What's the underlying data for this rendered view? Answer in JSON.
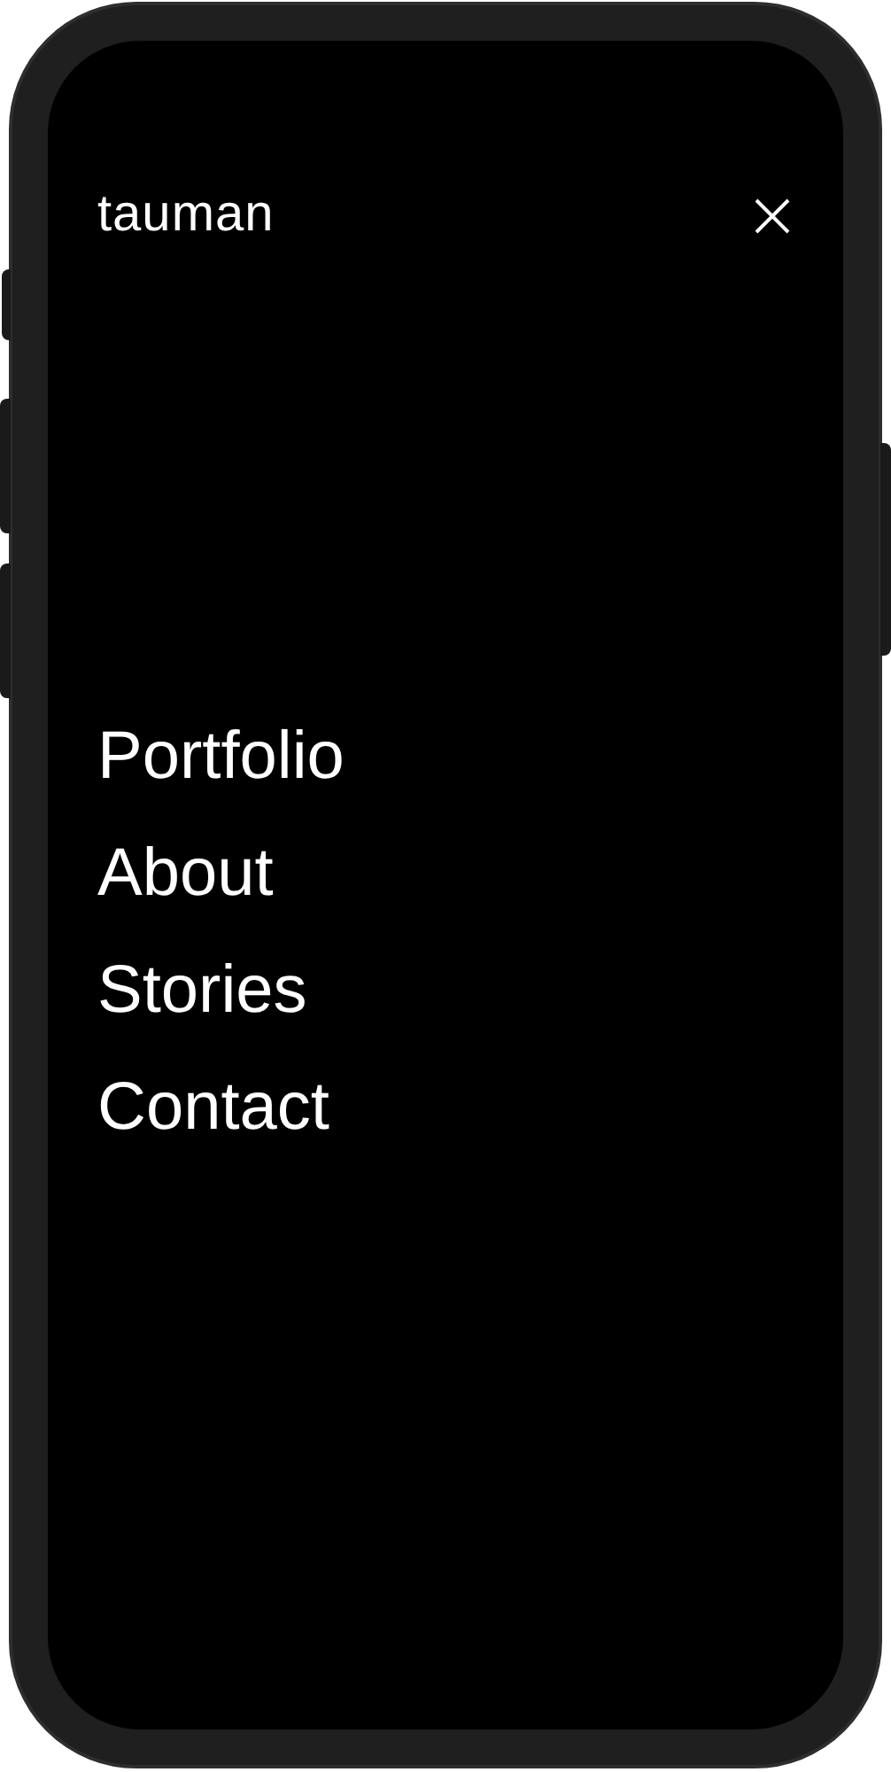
{
  "header": {
    "logo": "tauman"
  },
  "menu": [
    {
      "label": "Portfolio"
    },
    {
      "label": "About"
    },
    {
      "label": "Stories"
    },
    {
      "label": "Contact"
    }
  ]
}
